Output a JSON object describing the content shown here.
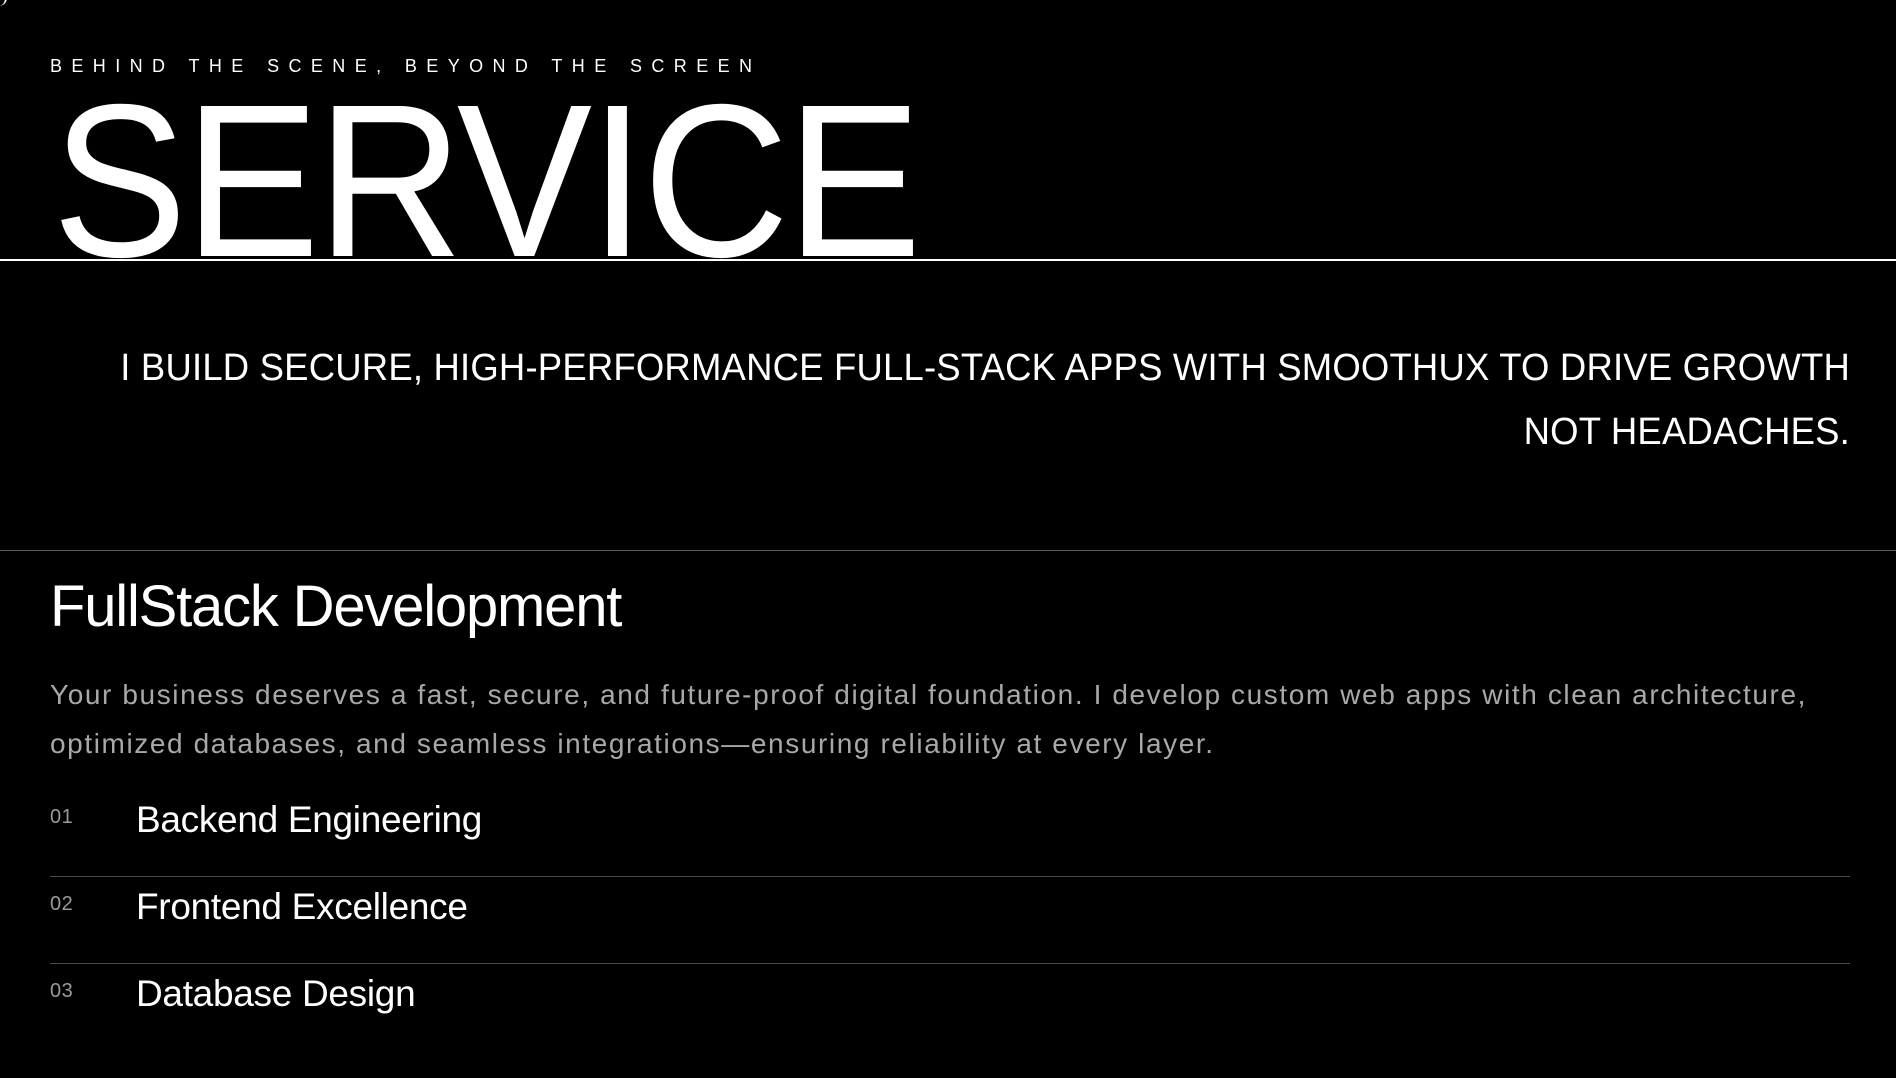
{
  "header": {
    "eyebrow": "BEHIND THE SCENE, BEYOND THE SCREEN",
    "title": "SERVICE"
  },
  "tagline": "I BUILD SECURE, HIGH-PERFORMANCE FULL-STACK APPS WITH SMOOTHUX TO DRIVE GROWTH NOT HEADACHES.",
  "section": {
    "title": "FullStack Development",
    "description": "Your business deserves a fast, secure, and future-proof digital foundation. I develop custom web apps with clean architecture, optimized databases, and seamless integrations—ensuring reliability at every layer.",
    "items": [
      {
        "number": "01",
        "label": "Backend Engineering"
      },
      {
        "number": "02",
        "label": "Frontend Excellence"
      },
      {
        "number": "03",
        "label": "Database Design"
      }
    ]
  },
  "colors": {
    "background": "#000000",
    "text": "#ffffff",
    "muted_text": "#a8a8a8",
    "divider": "#4a4a4a"
  }
}
